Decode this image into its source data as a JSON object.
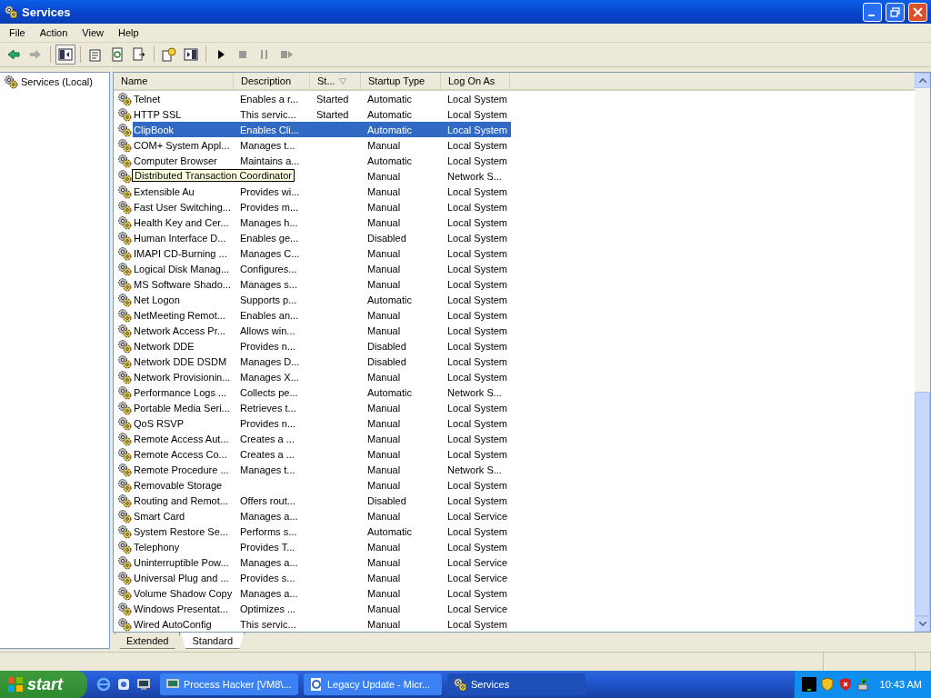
{
  "window": {
    "title": "Services"
  },
  "menu": [
    "File",
    "Action",
    "View",
    "Help"
  ],
  "tree": {
    "items": [
      {
        "label": "Services (Local)",
        "selected": false
      }
    ]
  },
  "table": {
    "columns": [
      {
        "label": "Name"
      },
      {
        "label": "Description"
      },
      {
        "label": "St...",
        "sorted": true
      },
      {
        "label": "Startup Type"
      },
      {
        "label": "Log On As"
      }
    ],
    "rows": [
      {
        "name": "Telnet",
        "description": "Enables a r...",
        "status": "Started",
        "startup": "Automatic",
        "logon": "Local System",
        "selected": false
      },
      {
        "name": "HTTP SSL",
        "description": "This servic...",
        "status": "Started",
        "startup": "Automatic",
        "logon": "Local System",
        "selected": false
      },
      {
        "name": "ClipBook",
        "description": "Enables Cli...",
        "startup": "Automatic",
        "logon": "Local System",
        "selected": true
      },
      {
        "name": "COM+ System Appl...",
        "description": "Manages t...",
        "startup": "Manual",
        "logon": "Local System",
        "selected": false
      },
      {
        "name": "Computer Browser",
        "description": "Maintains a...",
        "startup": "Automatic",
        "logon": "Local System",
        "selected": false
      },
      {
        "startup": "Manual",
        "logon": "Network S...",
        "selected": false,
        "tooltip": "Distributed Transaction Coordinator"
      },
      {
        "name": "Extensible Au",
        "description": "Provides wi...",
        "startup": "Manual",
        "logon": "Local System",
        "selected": false
      },
      {
        "name": "Fast User Switching...",
        "description": "Provides m...",
        "startup": "Manual",
        "logon": "Local System",
        "selected": false
      },
      {
        "name": "Health Key and Cer...",
        "description": "Manages h...",
        "startup": "Manual",
        "logon": "Local System",
        "selected": false
      },
      {
        "name": "Human Interface D...",
        "description": "Enables ge...",
        "startup": "Disabled",
        "logon": "Local System",
        "selected": false
      },
      {
        "name": "IMAPI CD-Burning ...",
        "description": "Manages C...",
        "startup": "Manual",
        "logon": "Local System",
        "selected": false
      },
      {
        "name": "Logical Disk Manag...",
        "description": "Configures...",
        "startup": "Manual",
        "logon": "Local System",
        "selected": false
      },
      {
        "name": "MS Software Shado...",
        "description": "Manages s...",
        "startup": "Manual",
        "logon": "Local System",
        "selected": false
      },
      {
        "name": "Net Logon",
        "description": "Supports p...",
        "startup": "Automatic",
        "logon": "Local System",
        "selected": false
      },
      {
        "name": "NetMeeting Remot...",
        "description": "Enables an...",
        "startup": "Manual",
        "logon": "Local System",
        "selected": false
      },
      {
        "name": "Network Access Pr...",
        "description": "Allows win...",
        "startup": "Manual",
        "logon": "Local System",
        "selected": false
      },
      {
        "name": "Network DDE",
        "description": "Provides n...",
        "startup": "Disabled",
        "logon": "Local System",
        "selected": false
      },
      {
        "name": "Network DDE DSDM",
        "description": "Manages D...",
        "startup": "Disabled",
        "logon": "Local System",
        "selected": false
      },
      {
        "name": "Network Provisionin...",
        "description": "Manages X...",
        "startup": "Manual",
        "logon": "Local System",
        "selected": false
      },
      {
        "name": "Performance Logs ...",
        "description": "Collects pe...",
        "startup": "Automatic",
        "logon": "Network S...",
        "selected": false
      },
      {
        "name": "Portable Media Seri...",
        "description": "Retrieves t...",
        "startup": "Manual",
        "logon": "Local System",
        "selected": false
      },
      {
        "name": "QoS RSVP",
        "description": "Provides n...",
        "startup": "Manual",
        "logon": "Local System",
        "selected": false
      },
      {
        "name": "Remote Access Aut...",
        "description": "Creates a ...",
        "startup": "Manual",
        "logon": "Local System",
        "selected": false
      },
      {
        "name": "Remote Access Co...",
        "description": "Creates a ...",
        "startup": "Manual",
        "logon": "Local System",
        "selected": false
      },
      {
        "name": "Remote Procedure ...",
        "description": "Manages t...",
        "startup": "Manual",
        "logon": "Network S...",
        "selected": false
      },
      {
        "name": "Removable Storage",
        "startup": "Manual",
        "logon": "Local System",
        "selected": false
      },
      {
        "name": "Routing and Remot...",
        "description": "Offers rout...",
        "startup": "Disabled",
        "logon": "Local System",
        "selected": false
      },
      {
        "name": "Smart Card",
        "description": "Manages a...",
        "startup": "Manual",
        "logon": "Local Service",
        "selected": false
      },
      {
        "name": "System Restore Se...",
        "description": "Performs s...",
        "startup": "Automatic",
        "logon": "Local System",
        "selected": false
      },
      {
        "name": "Telephony",
        "description": "Provides T...",
        "startup": "Manual",
        "logon": "Local System",
        "selected": false
      },
      {
        "name": "Uninterruptible Pow...",
        "description": "Manages a...",
        "startup": "Manual",
        "logon": "Local Service",
        "selected": false
      },
      {
        "name": "Universal Plug and ...",
        "description": "Provides s...",
        "startup": "Manual",
        "logon": "Local Service",
        "selected": false
      },
      {
        "name": "Volume Shadow Copy",
        "description": "Manages a...",
        "startup": "Manual",
        "logon": "Local System",
        "selected": false
      },
      {
        "name": "Windows Presentat...",
        "description": "Optimizes ...",
        "startup": "Manual",
        "logon": "Local Service",
        "selected": false
      },
      {
        "name": "Wired AutoConfig",
        "description": "This servic...",
        "startup": "Manual",
        "logon": "Local System",
        "selected": false
      }
    ]
  },
  "view_tabs": [
    {
      "label": "Extended",
      "selected": false
    },
    {
      "label": "Standard",
      "selected": true
    }
  ],
  "taskbar": {
    "start": "start",
    "tasks": [
      {
        "label": "Process Hacker [VM8\\...",
        "selected": false
      },
      {
        "label": "Legacy Update - Micr...",
        "selected": false
      },
      {
        "label": "Services",
        "selected": true
      }
    ],
    "clock": "10:43 AM"
  }
}
